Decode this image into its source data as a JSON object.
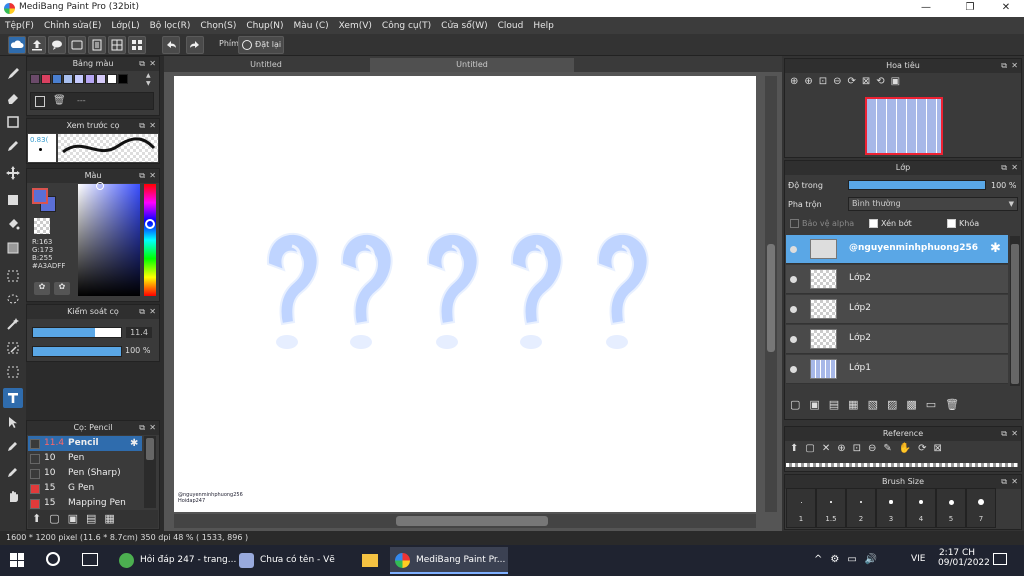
{
  "window": {
    "title": "MediBang Paint Pro (32bit)"
  },
  "menu": [
    "Tệp(F)",
    "Chỉnh sửa(E)",
    "Lớp(L)",
    "Bộ lọc(R)",
    "Chọn(S)",
    "Chụp(N)",
    "Màu (C)",
    "Xem(V)",
    "Công cụ(T)",
    "Cửa sổ(W)",
    "Cloud",
    "Help"
  ],
  "toolbar": {
    "shortcut_label": "Phím",
    "reset_label": "Đặt lại"
  },
  "tabs": [
    "Untitled",
    "Untitled"
  ],
  "palette": {
    "title": "Bảng màu",
    "dash": "---",
    "swatches": [
      "#6b4a6a",
      "#d94060",
      "#4a7fd0",
      "#a9c0f0",
      "#c7ccff",
      "#b7a7f4",
      "#d5caf8",
      "#ffffff",
      "#000000"
    ]
  },
  "brush_preview": {
    "title": "Xem trước cọ",
    "size": "0.83("
  },
  "color": {
    "title": "Màu",
    "r": "R:163",
    "g": "G:173",
    "b": "B:255",
    "hex": "#A3ADFF",
    "fg": "#d9534f",
    "bg": "#5b6fd6"
  },
  "brush_control": {
    "title": "Kiểm soát cọ",
    "size": "11.4",
    "opacity": "100 %",
    "size_fraction": 0.7,
    "opacity_fraction": 1.0
  },
  "brush_list": {
    "title": "Cọ: Pencil",
    "items": [
      {
        "size": "11.4",
        "name": "Pencil",
        "color": "#3a3a3a"
      },
      {
        "size": "10",
        "name": "Pen",
        "color": "#3a3a3a"
      },
      {
        "size": "10",
        "name": "Pen (Sharp)",
        "color": "#3a3a3a"
      },
      {
        "size": "15",
        "name": "G Pen",
        "color": "#e03a3a"
      },
      {
        "size": "15",
        "name": "Mapping Pen",
        "color": "#e03a3a"
      }
    ]
  },
  "navigator": {
    "title": "Hoa tiêu"
  },
  "layers": {
    "title": "Lớp",
    "opacity_label": "Độ trong",
    "opacity_value": "100 %",
    "opacity_fraction": 1.0,
    "blend_label": "Pha trộn",
    "blend_value": "Bình thường",
    "protect_alpha": "Bảo vệ alpha",
    "clipping": "Xén bớt",
    "lock": "Khóa",
    "items": [
      {
        "name": "@nguyenminhphuong256",
        "selected": true
      },
      {
        "name": "Lớp2",
        "selected": false
      },
      {
        "name": "Lớp2",
        "selected": false
      },
      {
        "name": "Lớp2",
        "selected": false
      },
      {
        "name": "Lớp1",
        "selected": false
      }
    ]
  },
  "reference": {
    "title": "Reference"
  },
  "brush_size": {
    "title": "Brush Size",
    "sizes": [
      "1",
      "1.5",
      "2",
      "3",
      "4",
      "5",
      "7"
    ]
  },
  "status": {
    "text": "1600 * 1200 pixel   (11.6 * 8.7cm)   350 dpi   48 %   ( 1533, 896 )"
  },
  "canvas": {
    "watermark_line1": "@nguyenminhphuong256",
    "watermark_line2": "Hoidap247"
  },
  "taskbar": {
    "apps": [
      "Hỏi đáp 247 - trang...",
      "Chưa có tên - Vẽ",
      "MediBang Paint Pr..."
    ],
    "lang": "VIE",
    "time": "2:17 CH",
    "date": "09/01/2022"
  }
}
